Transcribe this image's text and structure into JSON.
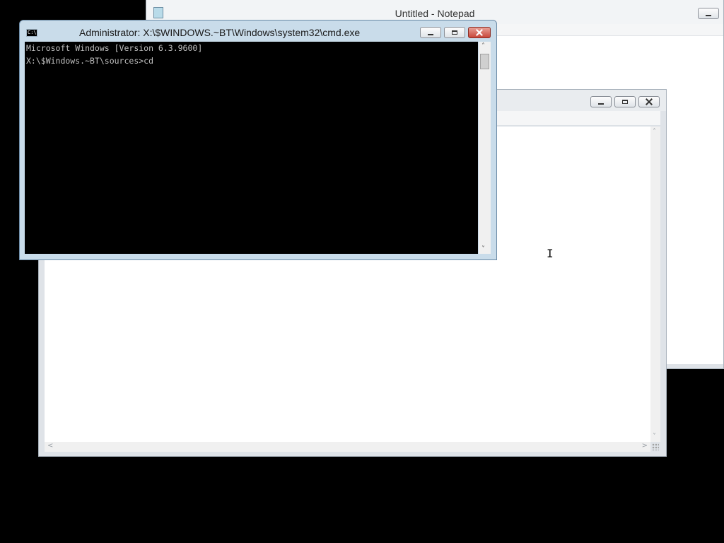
{
  "notepad_back": {
    "title": "Untitled - Notepad",
    "icon": "notepad-icon"
  },
  "notepad_front": {
    "title": "",
    "icon": "notepad-icon"
  },
  "cmd": {
    "title": "Administrator: X:\\$WINDOWS.~BT\\Windows\\system32\\cmd.exe",
    "icon": "cmd-icon",
    "lines": [
      "Microsoft Windows [Version 6.3.9600]",
      "",
      "X:\\$Windows.~BT\\sources>cd"
    ]
  },
  "cursor": {
    "type": "text-ibeam-cursor"
  },
  "colors": {
    "desktop": "#000000",
    "console_bg": "#000000",
    "console_text": "#c0c0c0",
    "close_button": "#c8473a"
  }
}
